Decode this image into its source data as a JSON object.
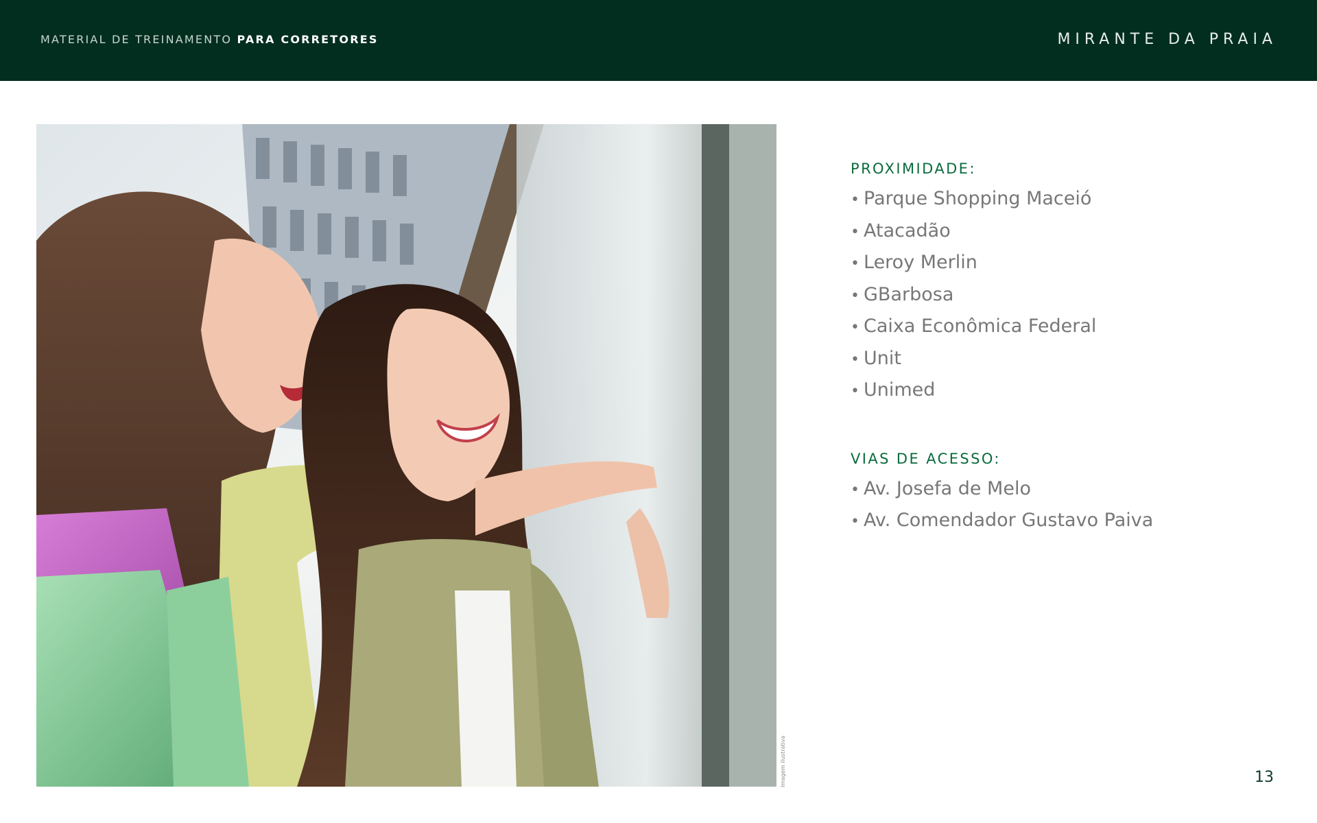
{
  "header": {
    "left_prefix": "MATERIAL DE TREINAMENTO",
    "left_bold": "PARA CORRETORES",
    "right_title": "MIRANTE DA PRAIA"
  },
  "photo": {
    "caption": "Imagem ilustrativa"
  },
  "proximity": {
    "title": "PROXIMIDADE:",
    "items": [
      "Parque Shopping Maceió",
      "Atacadão",
      "Leroy Merlin",
      "GBarbosa",
      "Caixa Econômica Federal",
      "Unit",
      "Unimed"
    ]
  },
  "access": {
    "title": "VIAS DE ACESSO:",
    "items": [
      "Av. Josefa de Melo",
      "Av. Comendador Gustavo Paiva"
    ]
  },
  "bullet": "•",
  "page_number": "13",
  "colors": {
    "header_bg": "#022e1f",
    "accent_green": "#0b6b3c",
    "body_text": "#777777"
  }
}
